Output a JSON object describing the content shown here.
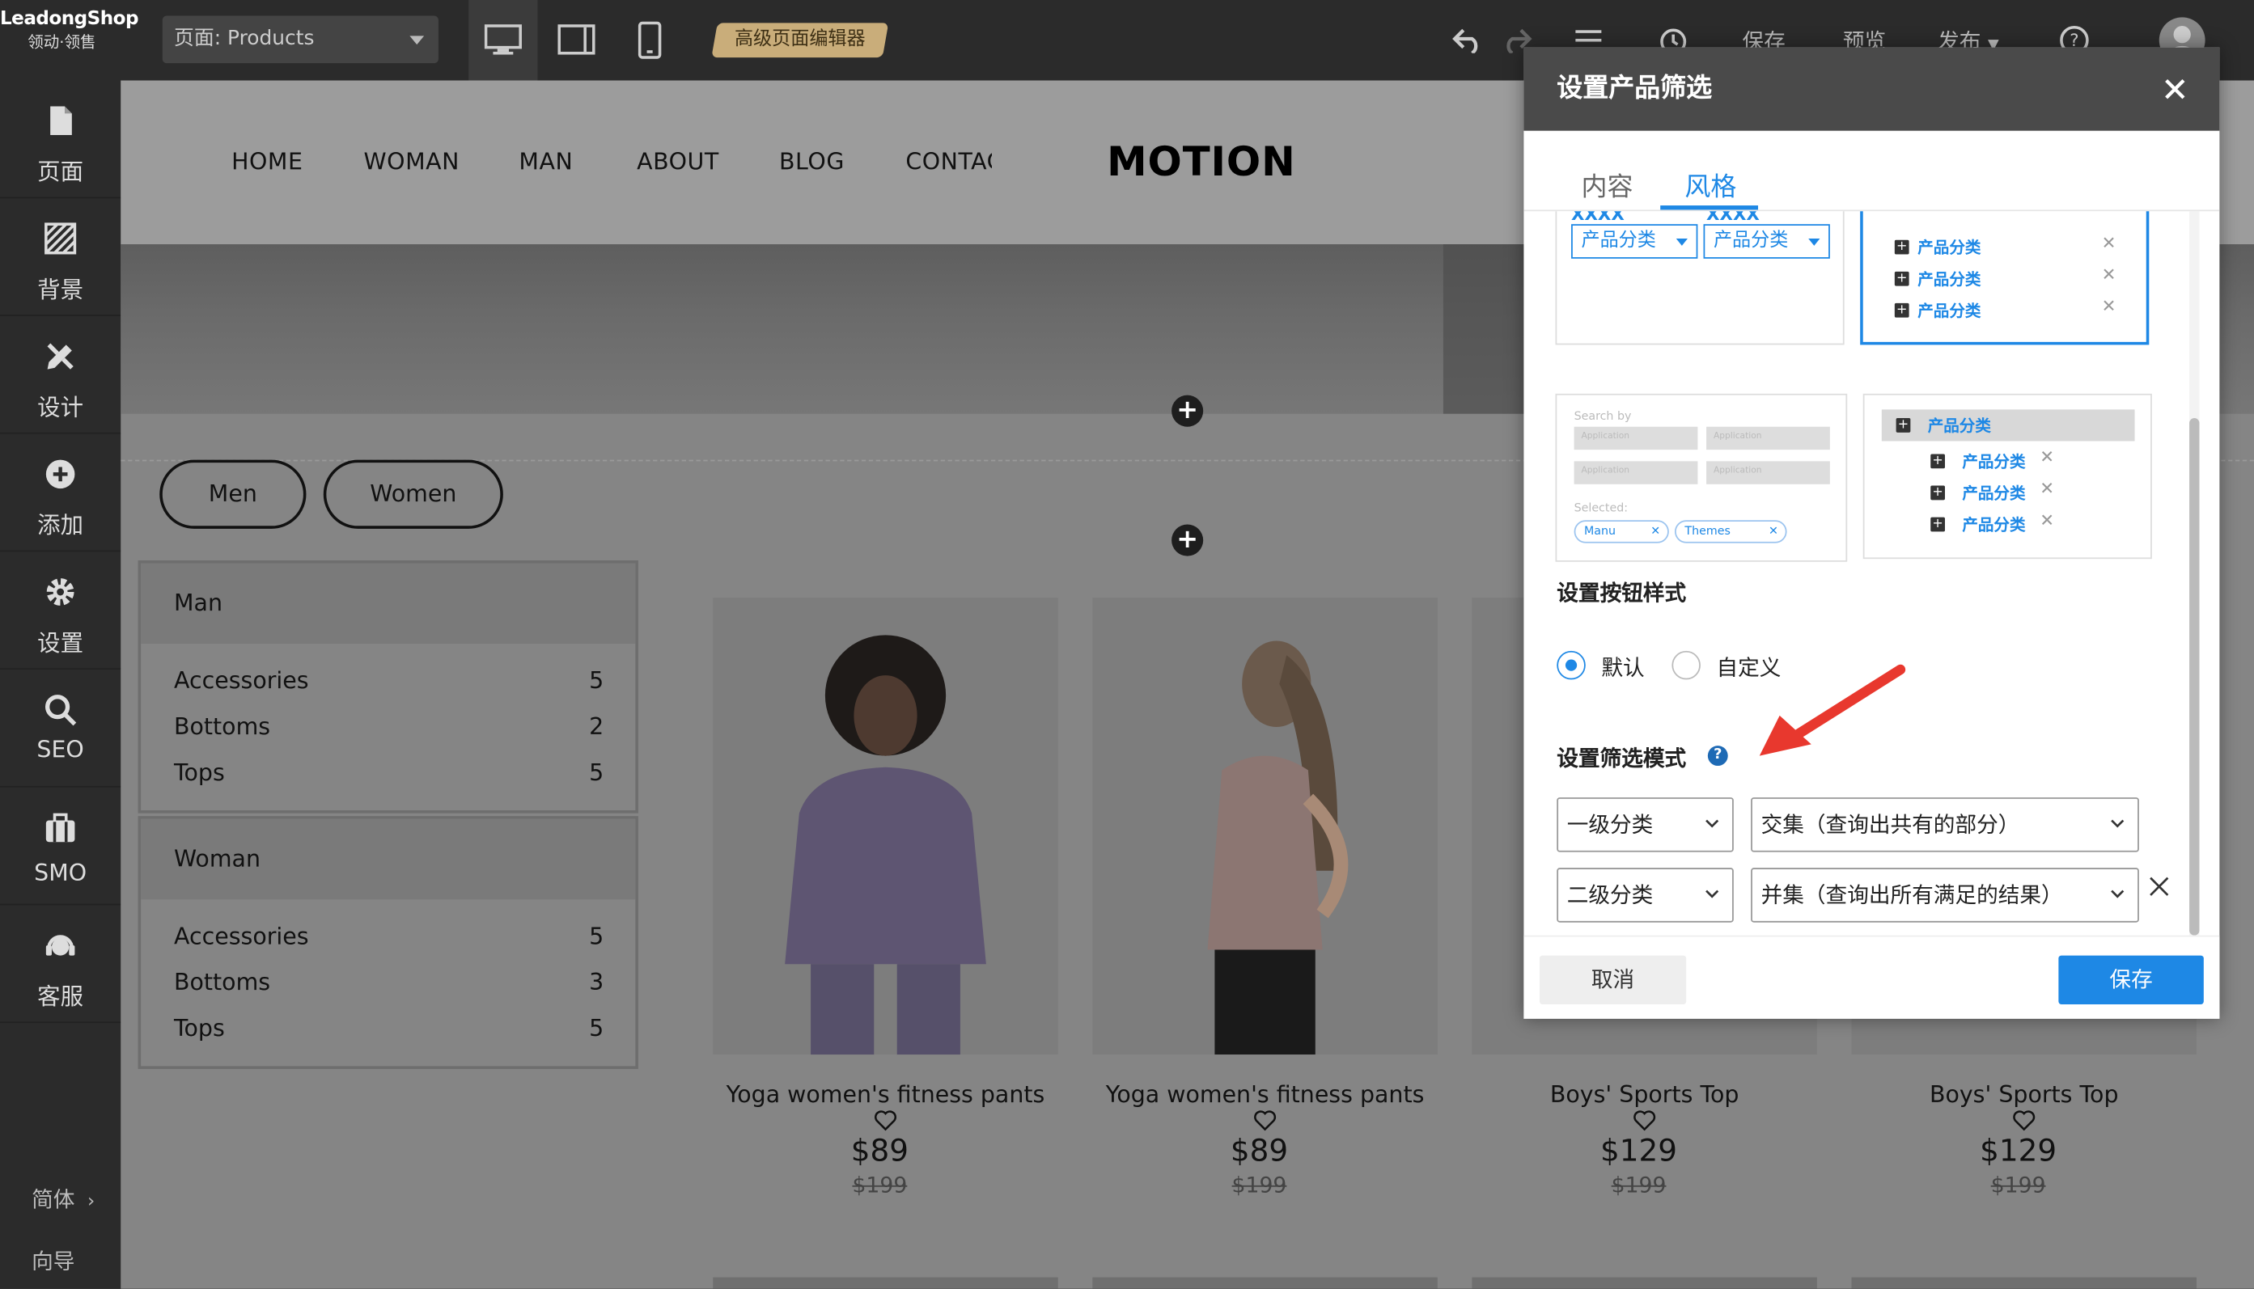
{
  "topbar": {
    "logo_line1": "LeadongShop",
    "logo_line2": "领动·领售",
    "page_select_value": "页面:  Products",
    "advanced_editor": "高级页面编辑器",
    "save": "保存",
    "preview": "预览",
    "publish": "发布"
  },
  "sidebar": {
    "items": [
      {
        "label": "页面",
        "icon": "page-icon"
      },
      {
        "label": "背景",
        "icon": "background-icon"
      },
      {
        "label": "设计",
        "icon": "design-icon"
      },
      {
        "label": "添加",
        "icon": "add-icon"
      },
      {
        "label": "设置",
        "icon": "gear-icon"
      },
      {
        "label": "SEO",
        "icon": "search-icon"
      },
      {
        "label": "SMO",
        "icon": "briefcase-icon"
      },
      {
        "label": "客服",
        "icon": "headset-icon"
      }
    ],
    "language": "简体",
    "guide": "向导"
  },
  "site": {
    "nav": [
      "HOME",
      "WOMAN",
      "MAN",
      "ABOUT",
      "BLOG",
      "CONTAC"
    ],
    "brand": "MOTION",
    "pills": [
      "Men",
      "Women"
    ],
    "categories": [
      {
        "title": "Man",
        "rows": [
          {
            "name": "Accessories",
            "count": "5"
          },
          {
            "name": "Bottoms",
            "count": "2"
          },
          {
            "name": "Tops",
            "count": "5"
          }
        ]
      },
      {
        "title": "Woman",
        "rows": [
          {
            "name": "Accessories",
            "count": "5"
          },
          {
            "name": "Bottoms",
            "count": "3"
          },
          {
            "name": "Tops",
            "count": "5"
          }
        ]
      }
    ],
    "products": [
      {
        "title": "Yoga women's fitness pants",
        "price": "$89",
        "old_price": "$199"
      },
      {
        "title": "Yoga women's fitness pants",
        "price": "$89",
        "old_price": "$199"
      },
      {
        "title": "Boys' Sports Top",
        "price": "$129",
        "old_price": "$199"
      },
      {
        "title": "Boys' Sports Top",
        "price": "$129",
        "old_price": "$199"
      }
    ]
  },
  "modal": {
    "title": "设置产品筛选",
    "tabs": [
      "内容",
      "风格"
    ],
    "active_tab": "风格",
    "thumbs": {
      "xxxx": "XXXX",
      "category": "产品分类",
      "search_by": "Search by",
      "application": "Application",
      "selected": "Selected:",
      "tag1": "Manu",
      "tag2": "Themes"
    },
    "button_style_title": "设置按钮样式",
    "radio_default": "默认",
    "radio_custom": "自定义",
    "filter_mode_title": "设置筛选模式",
    "row1_level": "一级分类",
    "row1_mode": "交集（查询出共有的部分）",
    "row2_level": "二级分类",
    "row2_mode": "并集（查询出所有满足的结果）",
    "cancel": "取消",
    "save": "保存"
  },
  "colors": {
    "accent": "#1e88e5",
    "topbar": "#2b2b2b",
    "badge": "#c9ad7a",
    "arrow": "#e8382e"
  }
}
